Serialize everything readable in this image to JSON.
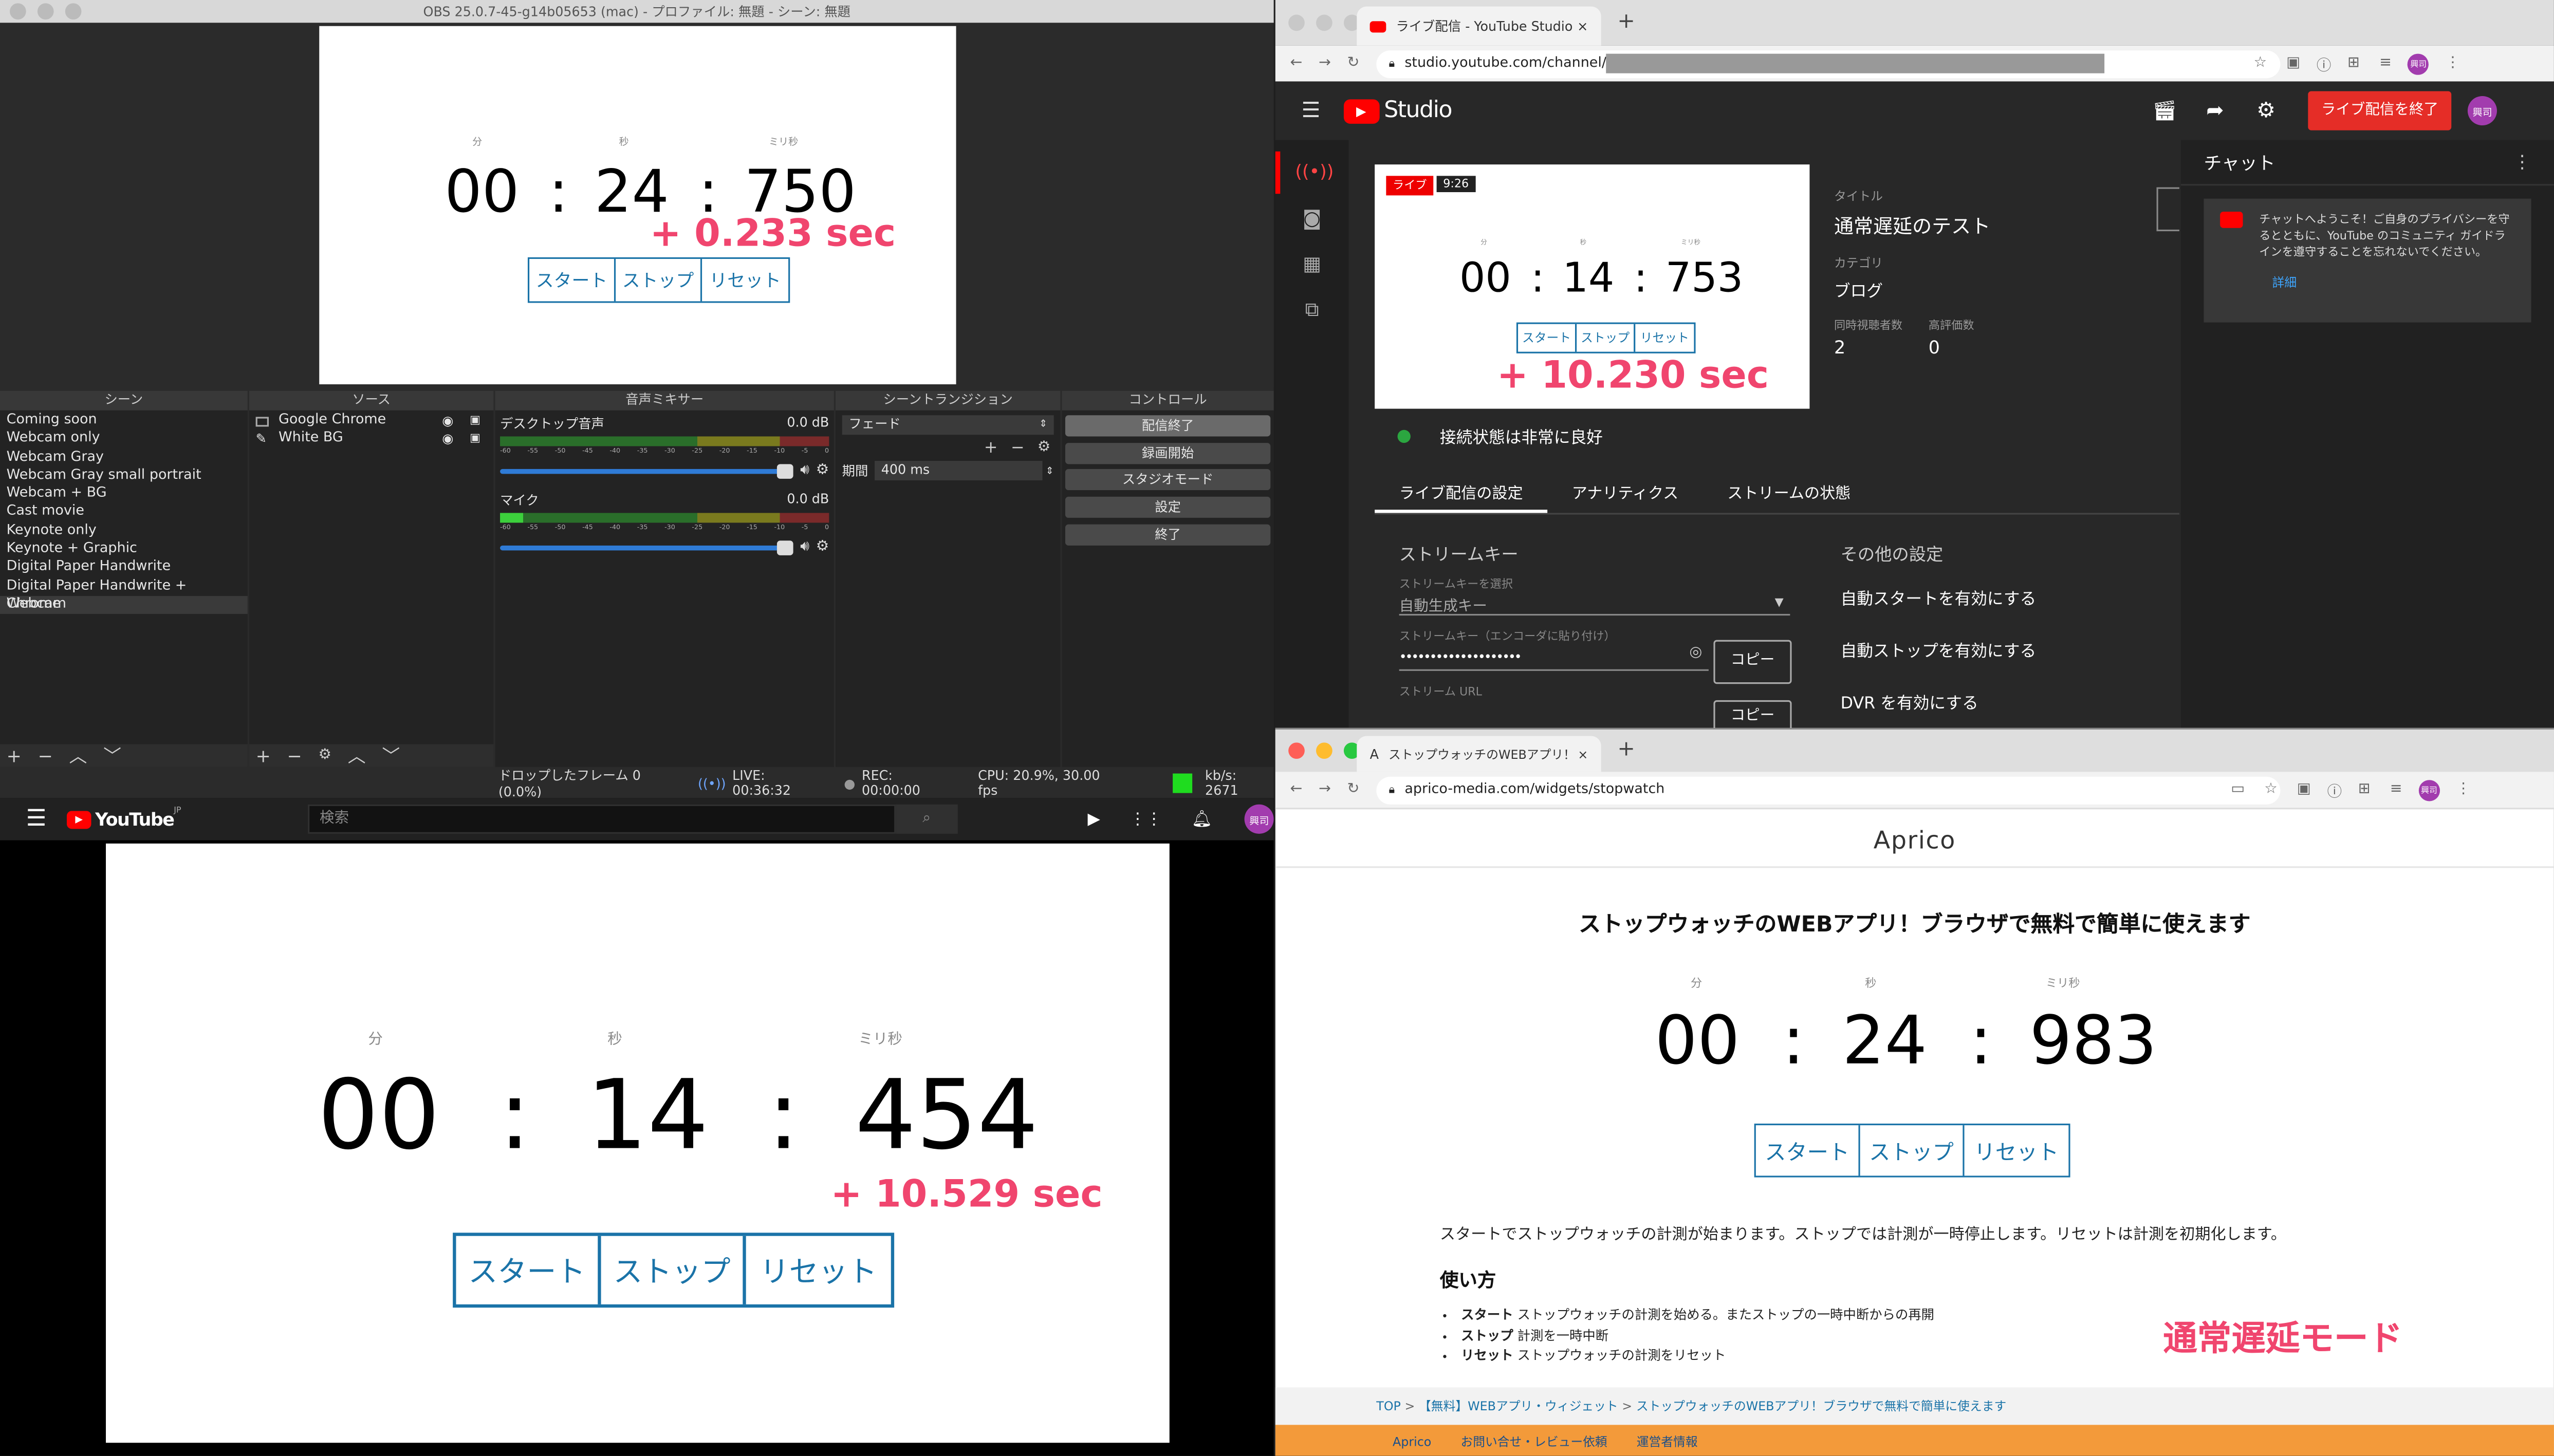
{
  "obs": {
    "title": "OBS 25.0.7-45-g14b05653 (mac) - プロファイル: 無題 - シーン: 無題",
    "preview": {
      "labels": {
        "min": "分",
        "sec": "秒",
        "ms": "ミリ秒"
      },
      "minutes": "00",
      "seconds": "24",
      "millis": "750",
      "delay": "+ 0.233 sec",
      "buttons": [
        "スタート",
        "ストップ",
        "リセット"
      ]
    },
    "panels": {
      "scenes_title": "シーン",
      "sources_title": "ソース",
      "mixer_title": "音声ミキサー",
      "transitions_title": "シーントランジション",
      "controls_title": "コントロール"
    },
    "scenes": [
      "Coming soon",
      "Webcam only",
      "Webcam Gray",
      "Webcam Gray small portrait",
      "Webcam + BG",
      "Cast movie",
      "Keynote only",
      "Keynote + Graphic",
      "Digital Paper Handwrite",
      "Digital Paper Handwrite + Webcam",
      "Chrome"
    ],
    "sources": [
      "Google Chrome",
      "White BG"
    ],
    "mixer": [
      {
        "name": "デスクトップ音声",
        "db": "0.0 dB"
      },
      {
        "name": "マイク",
        "db": "0.0 dB"
      }
    ],
    "meter_ticks": [
      "-60",
      "-55",
      "-50",
      "-45",
      "-40",
      "-35",
      "-30",
      "-25",
      "-20",
      "-15",
      "-10",
      "-5",
      "0"
    ],
    "transition": {
      "type": "フェード",
      "duration_label": "期間",
      "duration": "400 ms"
    },
    "controls": [
      "配信終了",
      "録画開始",
      "スタジオモード",
      "設定",
      "終了"
    ],
    "status": {
      "dropped": "ドロップしたフレーム 0 (0.0%)",
      "live": "LIVE: 00:36:32",
      "rec": "REC: 00:00:00",
      "cpu": "CPU: 20.9%, 30.00 fps",
      "kbs": "kb/s: 2671"
    }
  },
  "youtube_player": {
    "logo": "YouTube",
    "region": "JP",
    "search_placeholder": "検索",
    "avatar": "興司",
    "labels": {
      "min": "分",
      "sec": "秒",
      "ms": "ミリ秒"
    },
    "minutes": "00",
    "seconds": "14",
    "millis": "454",
    "delay": "+ 10.529 sec",
    "buttons": [
      "スタート",
      "ストップ",
      "リセット"
    ]
  },
  "studio": {
    "tab_title": "ライブ配信 - YouTube Studio",
    "url": "studio.youtube.com/channel/",
    "logo": "Studio",
    "end_button": "ライブ配信を終了",
    "avatar": "興司",
    "preview": {
      "live_badge": "ライブ",
      "time_badge": "9:26",
      "labels": {
        "min": "分",
        "sec": "秒",
        "ms": "ミリ秒"
      },
      "minutes": "00",
      "seconds": "14",
      "millis": "753",
      "buttons": [
        "スタート",
        "ストップ",
        "リセット"
      ],
      "delay": "+ 10.230 sec"
    },
    "meta": {
      "title_label": "タイトル",
      "title": "通常遅延のテスト",
      "category_label": "カテゴリ",
      "category": "ブログ",
      "viewers_label": "同時視聴者数",
      "viewers": "2",
      "likes_label": "高評価数",
      "likes": "0"
    },
    "connection": "接続状態は非常に良好",
    "tabs": [
      "ライブ配信の設定",
      "アナリティクス",
      "ストリームの状態"
    ],
    "stream_key": {
      "heading": "ストリームキー",
      "select_label": "ストリームキーを選択",
      "select_value": "自動生成キー",
      "key_label": "ストリームキー（エンコーダに貼り付け）",
      "key_value": "••••••••••••••••••••",
      "copy": "コピー",
      "url_label": "ストリーム URL",
      "copy2": "コピー"
    },
    "other": {
      "heading": "その他の設定",
      "items": [
        "自動スタートを有効にする",
        "自動ストップを有効にする",
        "DVR を有効にする"
      ]
    },
    "chat": {
      "title": "チャット",
      "message": "チャットへようこそ！ご自身のプライバシーを守るとともに、YouTube のコミュニティ ガイドラインを遵守することを忘れないでください。",
      "details": "詳細"
    }
  },
  "aprico": {
    "tab_title": "ストップウォッチのWEBアプリ！",
    "url": "aprico-media.com/widgets/stopwatch",
    "avatar": "興司",
    "site_name": "Aprico",
    "heading": "ストップウォッチのWEBアプリ！ブラウザで無料で簡単に使えます",
    "labels": {
      "min": "分",
      "sec": "秒",
      "ms": "ミリ秒"
    },
    "minutes": "00",
    "seconds": "24",
    "millis": "983",
    "buttons": [
      "スタート",
      "ストップ",
      "リセット"
    ],
    "description": "スタートでストップウォッチの計測が始まります。ストップでは計測が一時停止します。リセットは計測を初期化します。",
    "usage_heading": "使い方",
    "usage": [
      {
        "term": "スタート",
        "text": "ストップウォッチの計測を始める。またストップの一時中断からの再開"
      },
      {
        "term": "ストップ",
        "text": "計測を一時中断"
      },
      {
        "term": "リセット",
        "text": "ストップウォッチの計測をリセット"
      }
    ],
    "mode_overlay": "通常遅延モード",
    "breadcrumb": [
      "TOP",
      "【無料】WEBアプリ・ウィジェット",
      "ストップウォッチのWEBアプリ！ブラウザで無料で簡単に使えます"
    ],
    "breadcrumb_sep": ">",
    "footer": [
      "Aprico",
      "お問い合せ・レビュー依頼",
      "運営者情報"
    ]
  },
  "colors": {
    "accent_pink": "#f0456e",
    "yt_red": "#ff0000",
    "link_blue": "#1a73a8",
    "footer_orange": "#f39a3a"
  }
}
